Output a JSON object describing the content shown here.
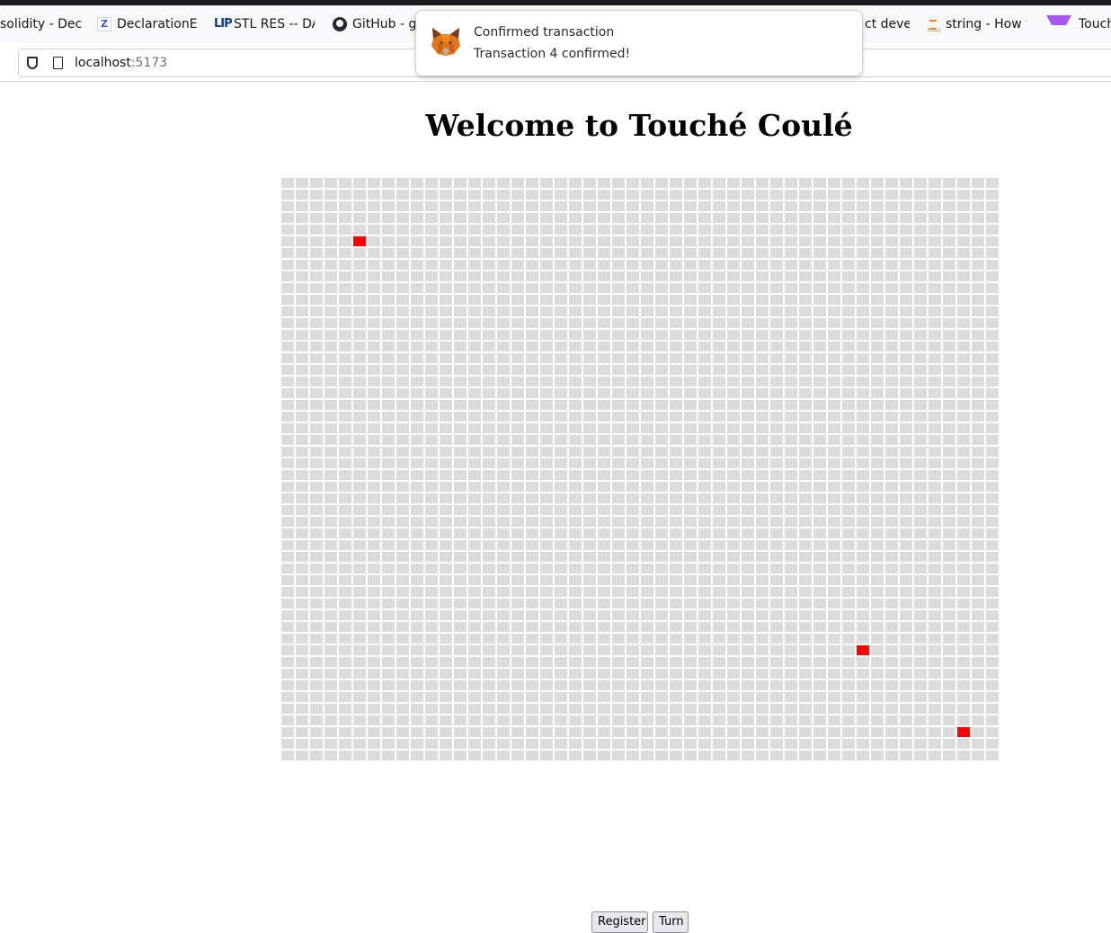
{
  "browser": {
    "bookmarks": [
      {
        "label": "solidity - Decl",
        "icon": "stackexchange-icon"
      },
      {
        "label": "DeclarationEr",
        "icon": "z-icon"
      },
      {
        "label": "STL RES -- DA",
        "icon": "lip-icon"
      },
      {
        "label": "GitHub - gl",
        "icon": "github-icon"
      },
      {
        "label": "ct deve",
        "icon": ""
      },
      {
        "label": "string - How t",
        "icon": "stackoverflow-icon"
      },
      {
        "label": "Touché (",
        "icon": "vite-icon"
      }
    ],
    "url": {
      "host": "localhost",
      "port": ":5173"
    }
  },
  "notification": {
    "title": "Confirmed transaction",
    "body": "Transaction 4 confirmed!",
    "icon": "metamask-fox-icon"
  },
  "page": {
    "title": "Welcome to Touché Coulé",
    "board": {
      "rows": 50,
      "cols": 50,
      "cell_color": "#dcdcdc",
      "hit_color": "#ff0000",
      "hits": [
        {
          "row": 5,
          "col": 5
        },
        {
          "row": 40,
          "col": 40
        },
        {
          "row": 47,
          "col": 47
        }
      ]
    },
    "buttons": {
      "register": "Register",
      "turn": "Turn"
    }
  }
}
